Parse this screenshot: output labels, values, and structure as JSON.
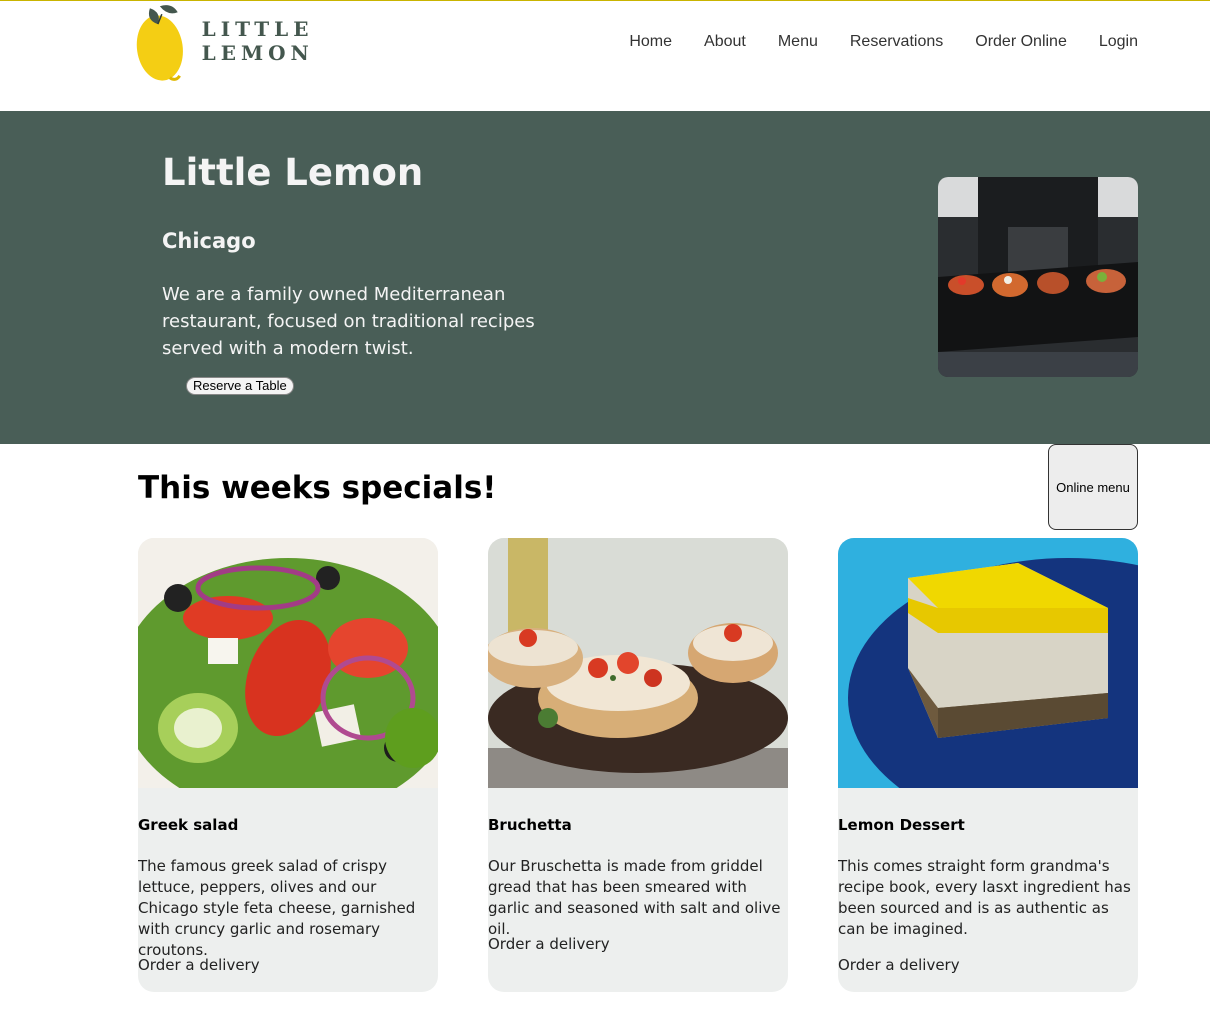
{
  "brand": {
    "name": "LITTLE LEMON",
    "logo_icon": "lemon-icon",
    "accent": "#f4ce14",
    "topline": "#c9b400"
  },
  "nav": {
    "items": [
      {
        "label": "Home"
      },
      {
        "label": "About"
      },
      {
        "label": "Menu"
      },
      {
        "label": "Reservations"
      },
      {
        "label": "Order Online"
      },
      {
        "label": "Login"
      }
    ]
  },
  "hero": {
    "title": "Little Lemon",
    "city": "Chicago",
    "description": "We are a family owned Mediterranean restaurant, focused on traditional recipes served with a modern twist.",
    "button_label": "Reserve a Table",
    "background": "#495e57"
  },
  "specials": {
    "heading": "This weeks specials!",
    "online_menu_label": "Online menu",
    "cards": [
      {
        "name": "Greek salad",
        "description": "The famous greek salad of crispy lettuce, peppers, olives and our Chicago style feta cheese, garnished with cruncy garlic and rosemary croutons.",
        "order_label": "Order a delivery"
      },
      {
        "name": "Bruchetta",
        "description": "Our Bruschetta is made from griddel gread that has been smeared with garlic and seasoned with salt and olive oil.",
        "order_label": "Order a delivery"
      },
      {
        "name": "Lemon Dessert",
        "description": "This comes straight form grandma's recipe book, every lasxt ingredient has been sourced and is as authentic as can be imagined.",
        "order_label": "Order a delivery"
      }
    ]
  }
}
